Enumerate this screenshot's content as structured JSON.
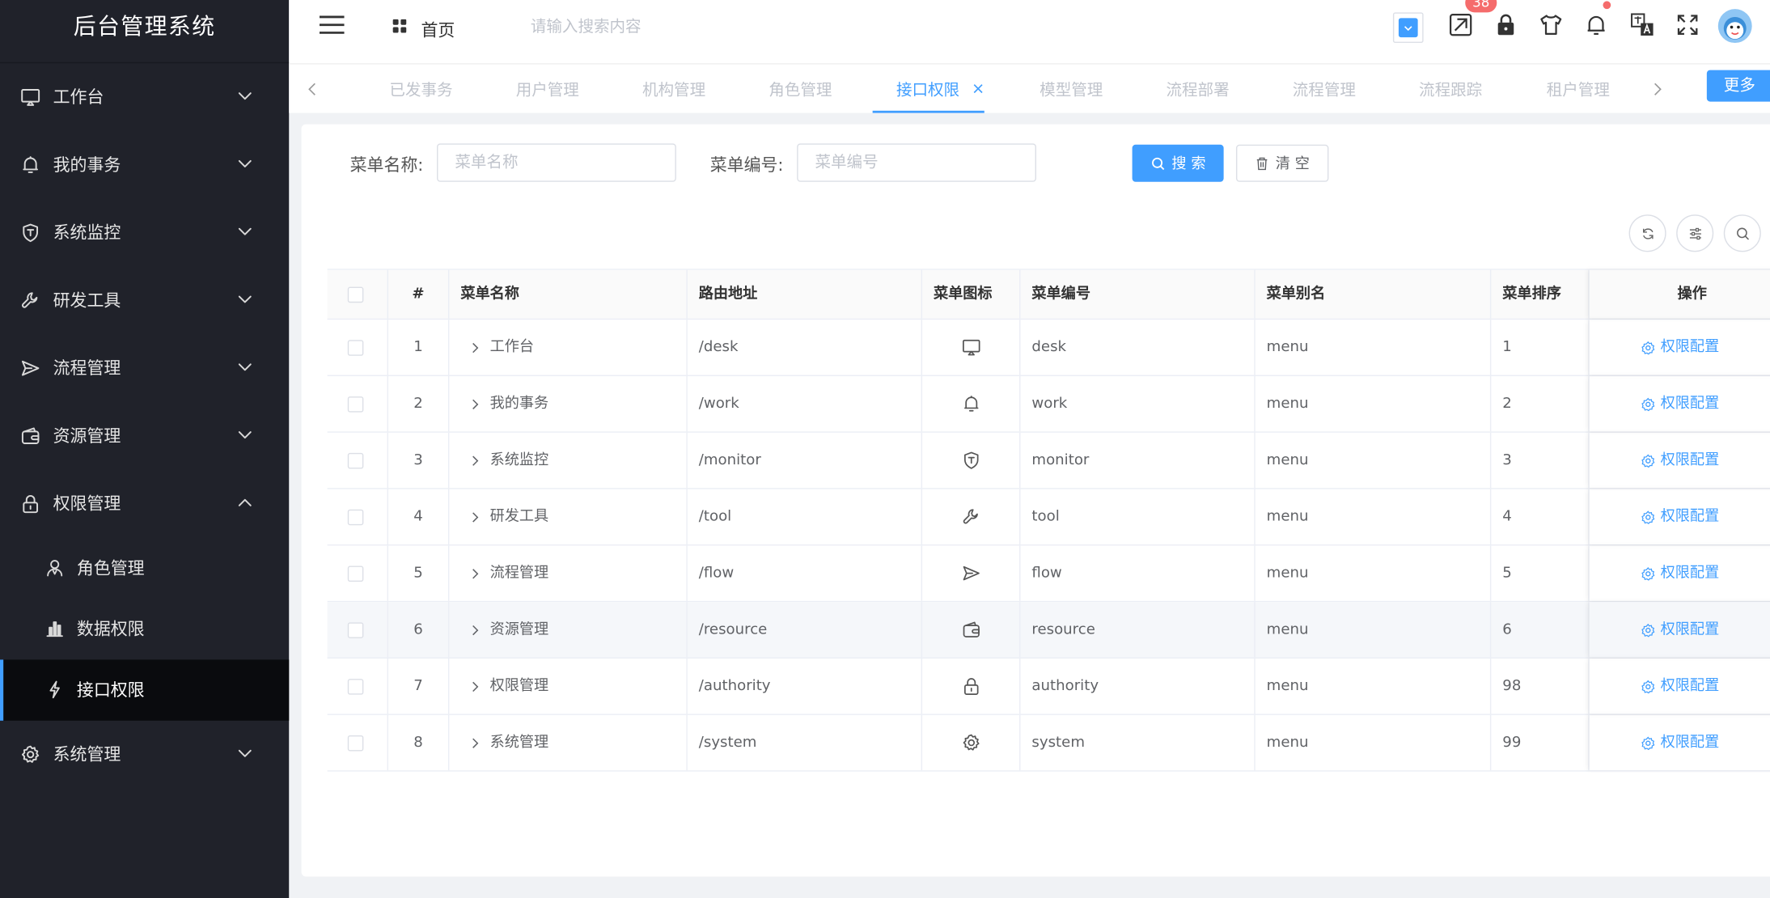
{
  "app": {
    "title": "后台管理系统"
  },
  "sidebar": {
    "items": [
      {
        "label": "工作台",
        "icon": "monitor-icon",
        "expanded": false
      },
      {
        "label": "我的事务",
        "icon": "bell-icon",
        "expanded": false
      },
      {
        "label": "系统监控",
        "icon": "shield-icon",
        "expanded": false
      },
      {
        "label": "研发工具",
        "icon": "wrench-icon",
        "expanded": false
      },
      {
        "label": "流程管理",
        "icon": "send-icon",
        "expanded": false
      },
      {
        "label": "资源管理",
        "icon": "wallet-icon",
        "expanded": false
      },
      {
        "label": "权限管理",
        "icon": "lock-icon",
        "expanded": true
      },
      {
        "label": "系统管理",
        "icon": "gear-icon",
        "expanded": false
      }
    ],
    "submenu": [
      {
        "label": "角色管理",
        "icon": "user-icon"
      },
      {
        "label": "数据权限",
        "icon": "bar-chart-icon"
      },
      {
        "label": "接口权限",
        "icon": "lightning-icon",
        "active": true
      }
    ]
  },
  "header": {
    "home_label": "首页",
    "search_placeholder": "请输入搜索内容",
    "badge_count": "38"
  },
  "tabs": {
    "items": [
      "已发事务",
      "用户管理",
      "机构管理",
      "角色管理",
      "接口权限",
      "模型管理",
      "流程部署",
      "流程管理",
      "流程跟踪",
      "租户管理"
    ],
    "active": "接口权限",
    "more_label": "更多"
  },
  "search_form": {
    "menu_name_label": "菜单名称:",
    "menu_name_placeholder": "菜单名称",
    "menu_code_label": "菜单编号:",
    "menu_code_placeholder": "菜单编号",
    "search_label": "搜 索",
    "clear_label": "清 空"
  },
  "table": {
    "columns": [
      "#",
      "菜单名称",
      "路由地址",
      "菜单图标",
      "菜单编号",
      "菜单别名",
      "菜单排序",
      "操作"
    ],
    "action_label": "权限配置",
    "rows": [
      {
        "index": "1",
        "name": "工作台",
        "path": "/desk",
        "icon": "monitor-icon",
        "code": "desk",
        "alias": "menu",
        "sort": "1"
      },
      {
        "index": "2",
        "name": "我的事务",
        "path": "/work",
        "icon": "bell-icon",
        "code": "work",
        "alias": "menu",
        "sort": "2"
      },
      {
        "index": "3",
        "name": "系统监控",
        "path": "/monitor",
        "icon": "shield-icon",
        "code": "monitor",
        "alias": "menu",
        "sort": "3"
      },
      {
        "index": "4",
        "name": "研发工具",
        "path": "/tool",
        "icon": "wrench-icon",
        "code": "tool",
        "alias": "menu",
        "sort": "4"
      },
      {
        "index": "5",
        "name": "流程管理",
        "path": "/flow",
        "icon": "send-icon",
        "code": "flow",
        "alias": "menu",
        "sort": "5"
      },
      {
        "index": "6",
        "name": "资源管理",
        "path": "/resource",
        "icon": "wallet-icon",
        "code": "resource",
        "alias": "menu",
        "sort": "6"
      },
      {
        "index": "7",
        "name": "权限管理",
        "path": "/authority",
        "icon": "lock-icon",
        "code": "authority",
        "alias": "menu",
        "sort": "98"
      },
      {
        "index": "8",
        "name": "系统管理",
        "path": "/system",
        "icon": "gear-icon",
        "code": "system",
        "alias": "menu",
        "sort": "99"
      }
    ]
  },
  "colors": {
    "primary": "#409eff",
    "sidebar_bg": "#20222a",
    "danger": "#f56c6c"
  }
}
